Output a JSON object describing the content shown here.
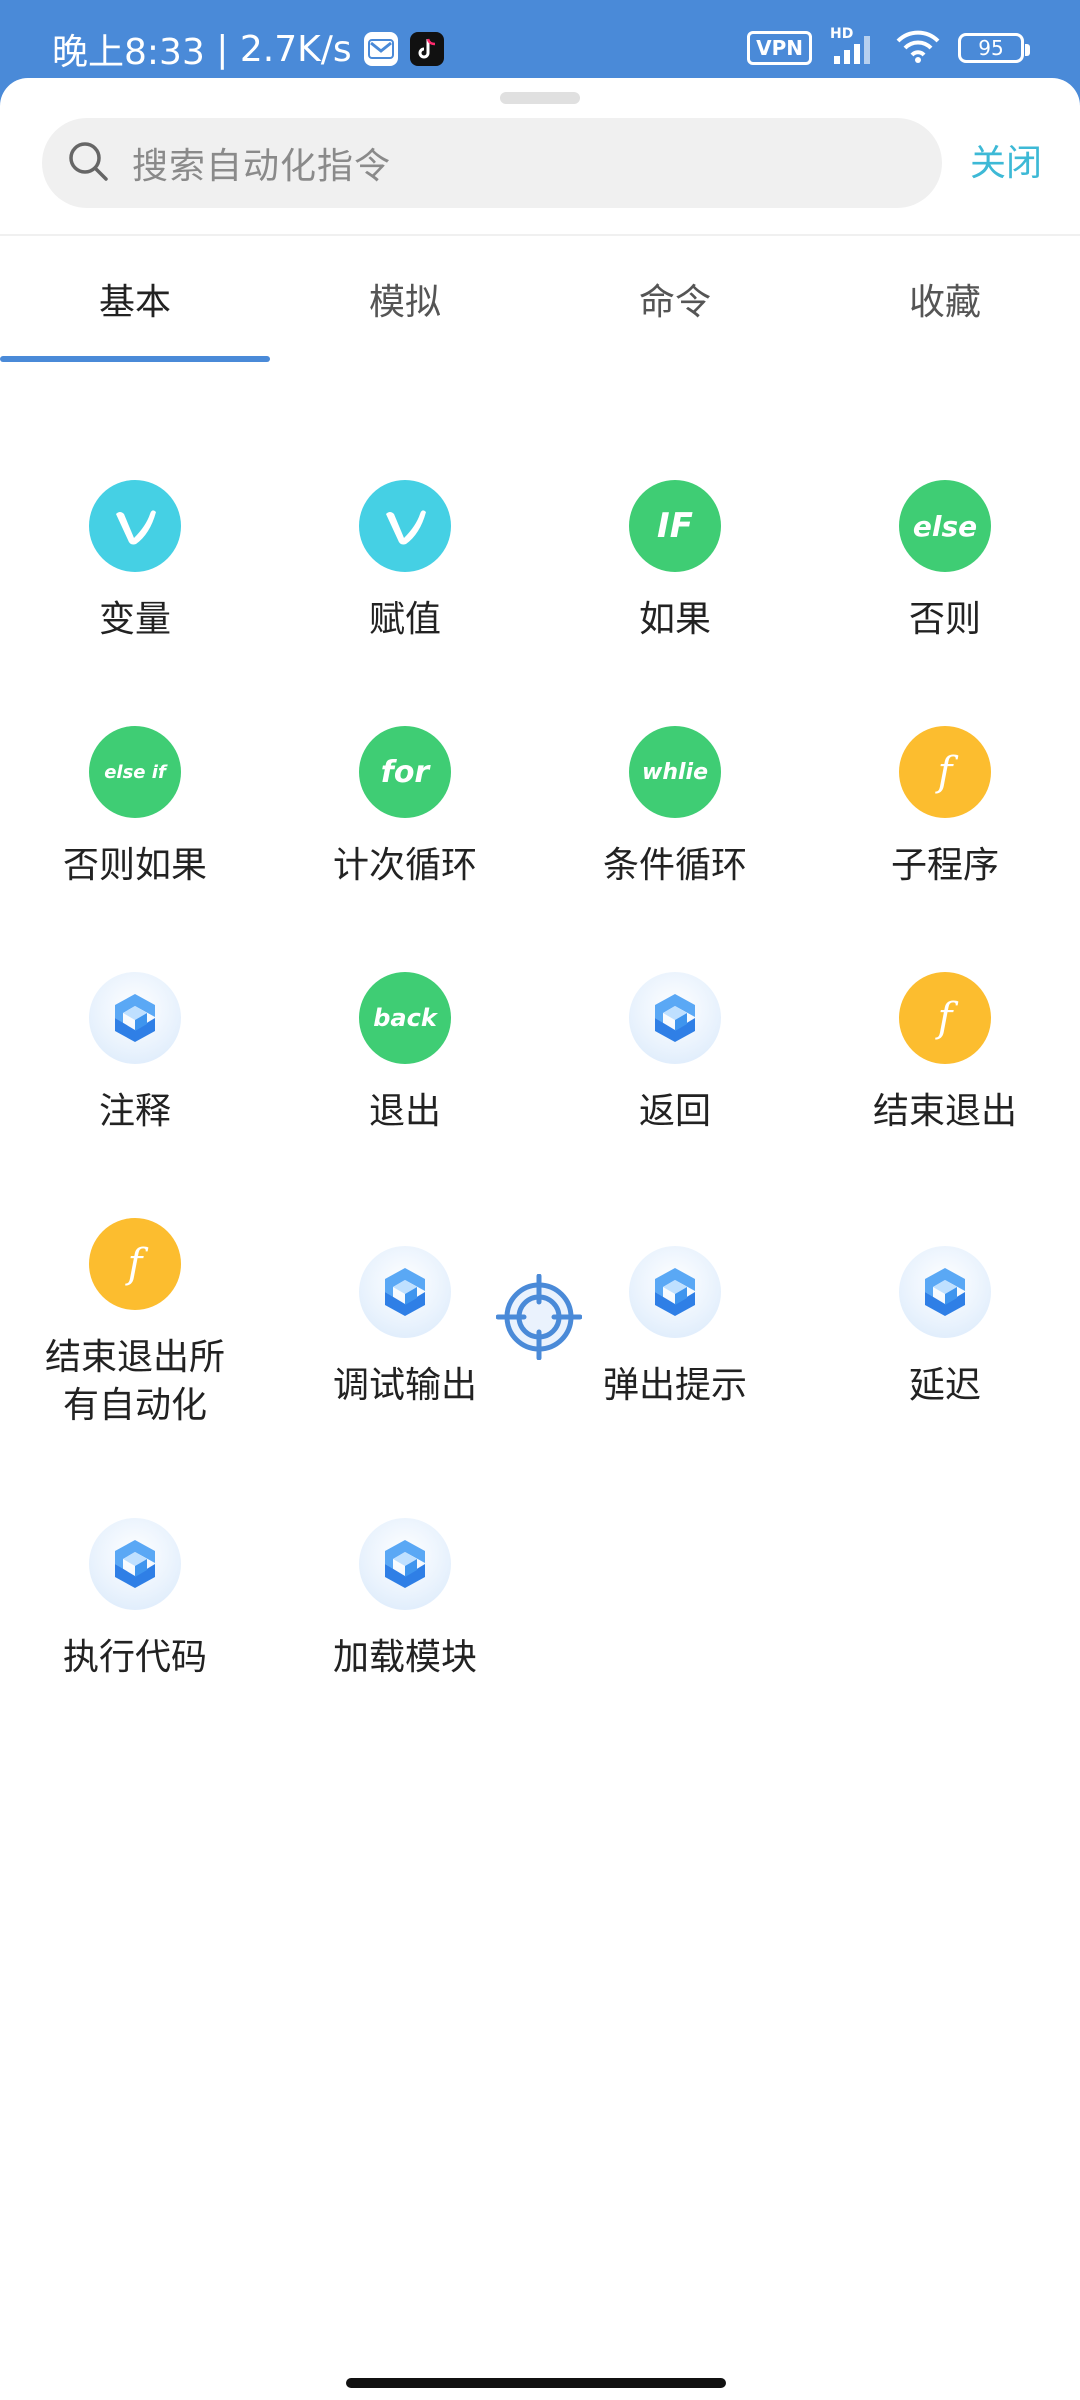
{
  "status": {
    "time": "晚上8:33",
    "net_speed": "2.7K/s",
    "vpn": "VPN",
    "signal_tag": "HD",
    "battery": "95"
  },
  "search": {
    "placeholder": "搜索自动化指令",
    "close_label": "关闭"
  },
  "tabs": [
    {
      "label": "基本",
      "active": true
    },
    {
      "label": "模拟",
      "active": false
    },
    {
      "label": "命令",
      "active": false
    },
    {
      "label": "收藏",
      "active": false
    }
  ],
  "items": [
    {
      "label": "变量",
      "icon": "v-icon",
      "glyph": "v",
      "color": "#45d0e4"
    },
    {
      "label": "赋值",
      "icon": "v-icon",
      "glyph": "v",
      "color": "#45d0e4"
    },
    {
      "label": "如果",
      "icon": "if-icon",
      "glyph": "IF",
      "color": "#3fcd74"
    },
    {
      "label": "否则",
      "icon": "else-icon",
      "glyph": "else",
      "color": "#3fcd74"
    },
    {
      "label": "否则如果",
      "icon": "else-if-icon",
      "glyph": "else if",
      "color": "#3fcd74"
    },
    {
      "label": "计次循环",
      "icon": "for-icon",
      "glyph": "for",
      "color": "#3fcd74"
    },
    {
      "label": "条件循环",
      "icon": "while-icon",
      "glyph": "whlie",
      "color": "#3fcd74"
    },
    {
      "label": "子程序",
      "icon": "function-icon",
      "glyph": "f",
      "color": "#fcbd2f"
    },
    {
      "label": "注释",
      "icon": "cube-logo-icon",
      "glyph": "",
      "color": "#d7e8fb"
    },
    {
      "label": "退出",
      "icon": "back-icon",
      "glyph": "back",
      "color": "#3fcd74"
    },
    {
      "label": "返回",
      "icon": "cube-logo-icon",
      "glyph": "",
      "color": "#d7e8fb"
    },
    {
      "label": "结束退出",
      "icon": "function-icon",
      "glyph": "f",
      "color": "#fcbd2f"
    },
    {
      "label": "结束退出所有自动化",
      "icon": "function-icon",
      "glyph": "f",
      "color": "#fcbd2f"
    },
    {
      "label": "调试输出",
      "icon": "cube-logo-icon",
      "glyph": "",
      "color": "#d7e8fb"
    },
    {
      "label": "弹出提示",
      "icon": "cube-logo-icon",
      "glyph": "",
      "color": "#d7e8fb"
    },
    {
      "label": "延迟",
      "icon": "cube-logo-icon",
      "glyph": "",
      "color": "#d7e8fb"
    },
    {
      "label": "执行代码",
      "icon": "cube-logo-icon",
      "glyph": "",
      "color": "#d7e8fb"
    },
    {
      "label": "加载模块",
      "icon": "cube-logo-icon",
      "glyph": "",
      "color": "#d7e8fb"
    }
  ],
  "colors": {
    "accent": "#4a8ad8",
    "close_link": "#3db9d6"
  }
}
